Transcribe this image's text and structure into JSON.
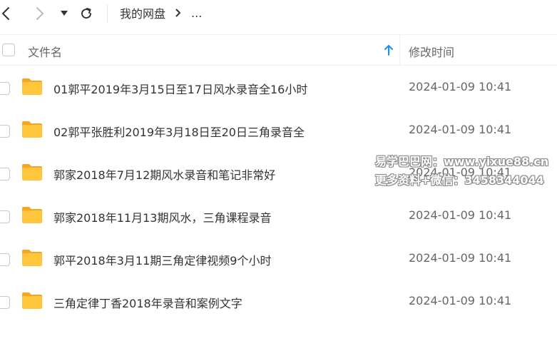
{
  "breadcrumb": {
    "root": "我的网盘",
    "more": "..."
  },
  "header": {
    "name_label": "文件名",
    "time_label": "修改时间"
  },
  "files": [
    {
      "name": "01郭平2019年3月15日至17日风水录音全16小时",
      "modified": "2024-01-09 10:41"
    },
    {
      "name": "02郭平张胜利2019年3月18日至20日三角录音全",
      "modified": "2024-01-09 10:41"
    },
    {
      "name": "郭家2018年7月12期风水录音和笔记非常好",
      "modified": "2024-01-09 10:41"
    },
    {
      "name": "郭家2018年11月13期风水，三角课程录音",
      "modified": "2024-01-09 10:41"
    },
    {
      "name": "郭平2018年3月11期三角定律视频9个小时",
      "modified": "2024-01-09 10:41"
    },
    {
      "name": "三角定律丁香2018年录音和案例文字",
      "modified": "2024-01-09 10:41"
    }
  ],
  "watermark": {
    "line1": "易学巴巴网：www.yixue88.cn",
    "line2": "更多资料+微信：3458344044"
  },
  "colors": {
    "folder": "#ffc53d",
    "folder_dark": "#f5a623",
    "sort_arrow": "#1890ff"
  }
}
